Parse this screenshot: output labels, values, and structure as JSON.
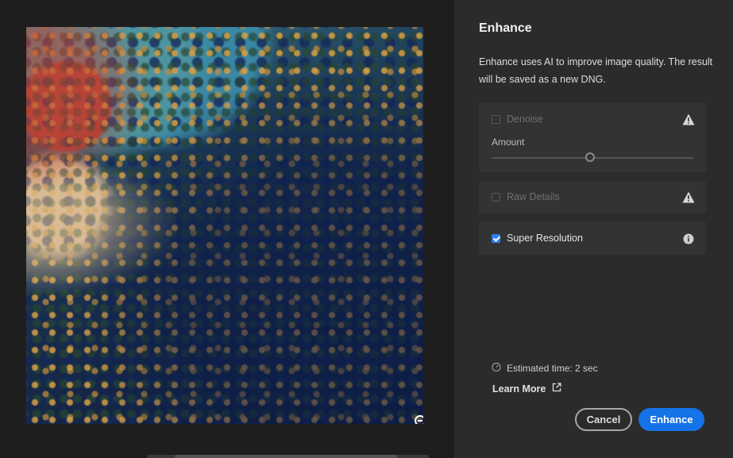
{
  "dialog": {
    "title": "Enhance",
    "description": "Enhance uses AI to improve image quality. The result will be saved as a new DNG."
  },
  "options": {
    "denoise": {
      "label": "Denoise",
      "checked": false,
      "enabled": false,
      "warning_icon": "warning-icon"
    },
    "amount": {
      "label": "Amount",
      "value_fraction": 0.49
    },
    "raw_details": {
      "label": "Raw Details",
      "checked": false,
      "enabled": false,
      "warning_icon": "warning-icon"
    },
    "super_resolution": {
      "label": "Super Resolution",
      "checked": true,
      "enabled": true,
      "info_icon": "info-icon"
    }
  },
  "footer": {
    "estimated_time": "Estimated time: 2 sec",
    "learn_more": "Learn More",
    "cancel_label": "Cancel",
    "enhance_label": "Enhance"
  },
  "preview": {
    "zoom_icon": "zoom-out-icon"
  },
  "colors": {
    "accent": "#1473e6",
    "panel_bg": "#2b2b2b",
    "card_bg": "#333333"
  }
}
